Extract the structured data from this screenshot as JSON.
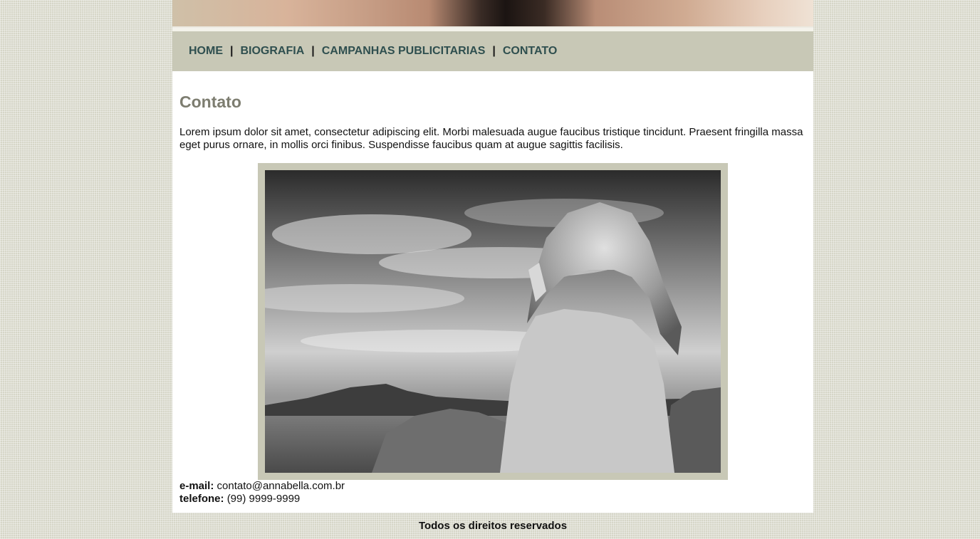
{
  "nav": {
    "items": [
      {
        "label": "HOME"
      },
      {
        "label": "BIOGRAFIA"
      },
      {
        "label": "CAMPANHAS PUBLICITARIAS"
      },
      {
        "label": "CONTATO"
      }
    ],
    "separator": "|"
  },
  "page": {
    "title": "Contato",
    "lead": "Lorem ipsum dolor sit amet, consectetur adipiscing elit. Morbi malesuada augue faucibus tristique tincidunt. Praesent fringilla massa eget purus ornare, in mollis orci finibus. Suspendisse faucibus quam at augue sagittis facilisis."
  },
  "contact": {
    "email_label": "e-mail:",
    "email_value": "contato@annabella.com.br",
    "phone_label": "telefone:",
    "phone_value": "(99) 9999-9999"
  },
  "footer": {
    "text": "Todos os direitos reservados"
  },
  "colors": {
    "nav_bg": "#c8c8b6",
    "nav_text": "#2f4f4f",
    "title": "#7d7d70",
    "frame": "#c8c8b6"
  }
}
